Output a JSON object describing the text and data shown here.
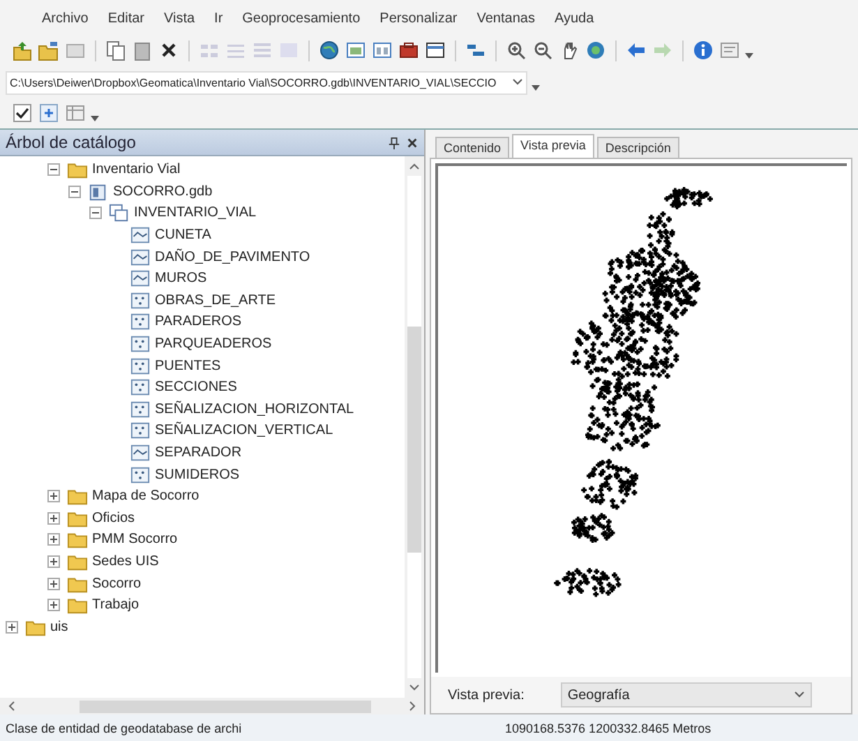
{
  "menu": [
    "Archivo",
    "Editar",
    "Vista",
    "Ir",
    "Geoprocesamiento",
    "Personalizar",
    "Ventanas",
    "Ayuda"
  ],
  "address": {
    "value": "C:\\Users\\Deiwer\\Dropbox\\Geomatica\\Inventario Vial\\SOCORRO.gdb\\INVENTARIO_VIAL\\SECCIO"
  },
  "catalog": {
    "title": "Árbol de catálogo",
    "items": [
      {
        "label": "Inventario Vial",
        "kind": "folder",
        "expanded": true,
        "children": [
          {
            "label": "SOCORRO.gdb",
            "kind": "gdb",
            "expanded": true,
            "children": [
              {
                "label": "INVENTARIO_VIAL",
                "kind": "dataset",
                "expanded": true,
                "children": [
                  {
                    "label": "CUNETA",
                    "kind": "line"
                  },
                  {
                    "label": "DAÑO_DE_PAVIMENTO",
                    "kind": "line"
                  },
                  {
                    "label": "MUROS",
                    "kind": "line"
                  },
                  {
                    "label": "OBRAS_DE_ARTE",
                    "kind": "point"
                  },
                  {
                    "label": "PARADEROS",
                    "kind": "point"
                  },
                  {
                    "label": "PARQUEADEROS",
                    "kind": "point"
                  },
                  {
                    "label": "PUENTES",
                    "kind": "point"
                  },
                  {
                    "label": "SECCIONES",
                    "kind": "point"
                  },
                  {
                    "label": "SEÑALIZACION_HORIZONTAL",
                    "kind": "point"
                  },
                  {
                    "label": "SEÑALIZACION_VERTICAL",
                    "kind": "point"
                  },
                  {
                    "label": "SEPARADOR",
                    "kind": "line"
                  },
                  {
                    "label": "SUMIDEROS",
                    "kind": "point"
                  }
                ]
              }
            ]
          }
        ]
      },
      {
        "label": "Mapa de Socorro",
        "kind": "folder",
        "expanded": false
      },
      {
        "label": "Oficios",
        "kind": "folder",
        "expanded": false
      },
      {
        "label": "PMM Socorro",
        "kind": "folder",
        "expanded": false
      },
      {
        "label": "Sedes UIS",
        "kind": "folder",
        "expanded": false
      },
      {
        "label": "Socorro",
        "kind": "folder",
        "expanded": false
      },
      {
        "label": "Trabajo",
        "kind": "folder",
        "expanded": false
      }
    ],
    "root_items": [
      {
        "label": "uis",
        "kind": "folder",
        "expanded": false
      }
    ]
  },
  "tabs": [
    {
      "label": "Contenido",
      "selected": false
    },
    {
      "label": "Vista previa",
      "selected": true
    },
    {
      "label": "Descripción",
      "selected": false
    }
  ],
  "preview": {
    "label": "Vista previa:",
    "value": "Geografía"
  },
  "status_bar": {
    "left": "Clase de entidad de geodatabase de archi",
    "right": "1090168.5376  1200332.8465 Metros"
  }
}
